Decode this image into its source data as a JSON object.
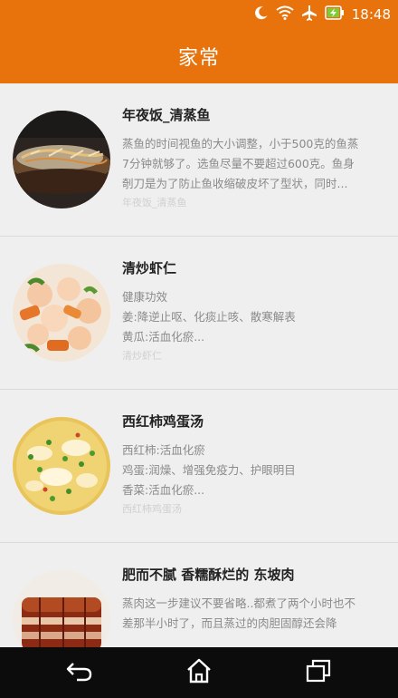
{
  "status": {
    "time": "18:48"
  },
  "header": {
    "title": "家常"
  },
  "items": [
    {
      "title": "年夜饭_清蒸鱼",
      "lines": [
        "蒸鱼的时间视鱼的大小调整，小于500克的鱼蒸",
        "7分钟就够了。选鱼尽量不要超过600克。鱼身",
        "剞刀是为了防止鱼收缩破皮坏了型状，同时..."
      ],
      "tag": "年夜饭_清蒸鱼"
    },
    {
      "title": "清炒虾仁",
      "lines": [
        "健康功效",
        "姜:降逆止呕、化痰止咳、散寒解表",
        "黄瓜:活血化瘀..."
      ],
      "tag": "清炒虾仁"
    },
    {
      "title": "西红柿鸡蛋汤",
      "lines": [
        "西红柿:活血化瘀",
        "鸡蛋:润燥、增强免疫力、护眼明目",
        "香菜:活血化瘀..."
      ],
      "tag": "西红柿鸡蛋汤"
    },
    {
      "title": "肥而不腻 香糯酥烂的 东坡肉",
      "lines": [
        "蒸肉这一步建议不要省略..都煮了两个小时也不",
        "差那半小时了，而且蒸过的肉胆固醇还会降"
      ],
      "tag": ""
    }
  ],
  "icons": [
    "moon-icon",
    "wifi-icon",
    "airplane-icon",
    "battery-charging-icon",
    "back-icon",
    "home-icon",
    "recents-icon"
  ],
  "colors": {
    "primary": "#e8730c",
    "background": "#efefef",
    "navbar": "#0c0c0c"
  }
}
